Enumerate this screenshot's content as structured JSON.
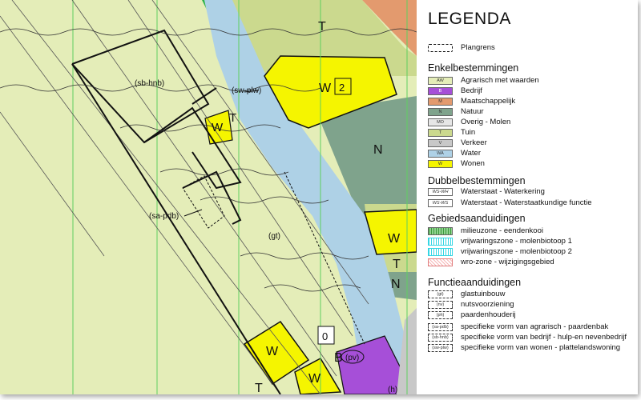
{
  "map_labels": {
    "w1": "W",
    "w1_num": "2",
    "w_t_small": "W",
    "t_small": "T",
    "t_top": "T",
    "n_big": "N",
    "w_right": "W",
    "t_right": "T",
    "n_right": "N",
    "sb_hnb": "(sb-hnb)",
    "sw_plw": "(sw-plw)",
    "sa_pdb": "(sa-pdb)",
    "gt": "(gt)",
    "w_bottom1": "W",
    "w_bottom2": "W",
    "zero": "0",
    "b_pv": "B",
    "pv": "(pv)",
    "h": "(h)",
    "t_bottom": "T"
  },
  "legend": {
    "title": "LEGENDA",
    "plangrens": "Plangrens",
    "sections": [
      {
        "title": "Enkelbestemmingen",
        "items": [
          {
            "code": "AW",
            "label": "Agrarisch met waarden",
            "color": "#e4edb8"
          },
          {
            "code": "B",
            "label": "Bedrijf",
            "color": "#a64fd8"
          },
          {
            "code": "M",
            "label": "Maatschappelijk",
            "color": "#e39a6e"
          },
          {
            "code": "N",
            "label": "Natuur",
            "color": "#7fa38c"
          },
          {
            "code": "MO",
            "label": "Overig - Molen",
            "color": "#e6e6e6"
          },
          {
            "code": "T",
            "label": "Tuin",
            "color": "#cbd98e"
          },
          {
            "code": "V",
            "label": "Verkeer",
            "color": "#c8c8c8"
          },
          {
            "code": "WA",
            "label": "Water",
            "color": "#aed1e6"
          },
          {
            "code": "W",
            "label": "Wonen",
            "color": "#f5f500"
          }
        ]
      },
      {
        "title": "Dubbelbestemmingen",
        "items": [
          {
            "code": "WS-WH",
            "label": "Waterstaat - Waterkering"
          },
          {
            "code": "WS-WS",
            "label": "Waterstaat - Waterstaatkundige functie"
          }
        ]
      },
      {
        "title": "Gebiedsaanduidingen",
        "items": [
          {
            "label": "milieuzone - eendenkooi"
          },
          {
            "label": "vrijwaringszone - molenbiotoop 1"
          },
          {
            "label": "vrijwaringszone - molenbiotoop 2"
          },
          {
            "label": "wro-zone - wijzigingsgebied"
          }
        ]
      },
      {
        "title": "Functieaanduidingen",
        "items": [
          {
            "code": "(gt)",
            "label": "glastuinbouw"
          },
          {
            "code": "(nv)",
            "label": "nutsvoorziening"
          },
          {
            "code": "(ph)",
            "label": "paardenhouderij"
          },
          {
            "code": "(sa-pdb)",
            "label": "specifieke vorm van agrarisch - paardenbak"
          },
          {
            "code": "(sb-hnb)",
            "label": "specifieke vorm van bedrijf - hulp-en nevenbedrijf"
          },
          {
            "code": "(sw-plw)",
            "label": "specifieke vorm van wonen - plattelandswoning"
          }
        ]
      }
    ]
  }
}
